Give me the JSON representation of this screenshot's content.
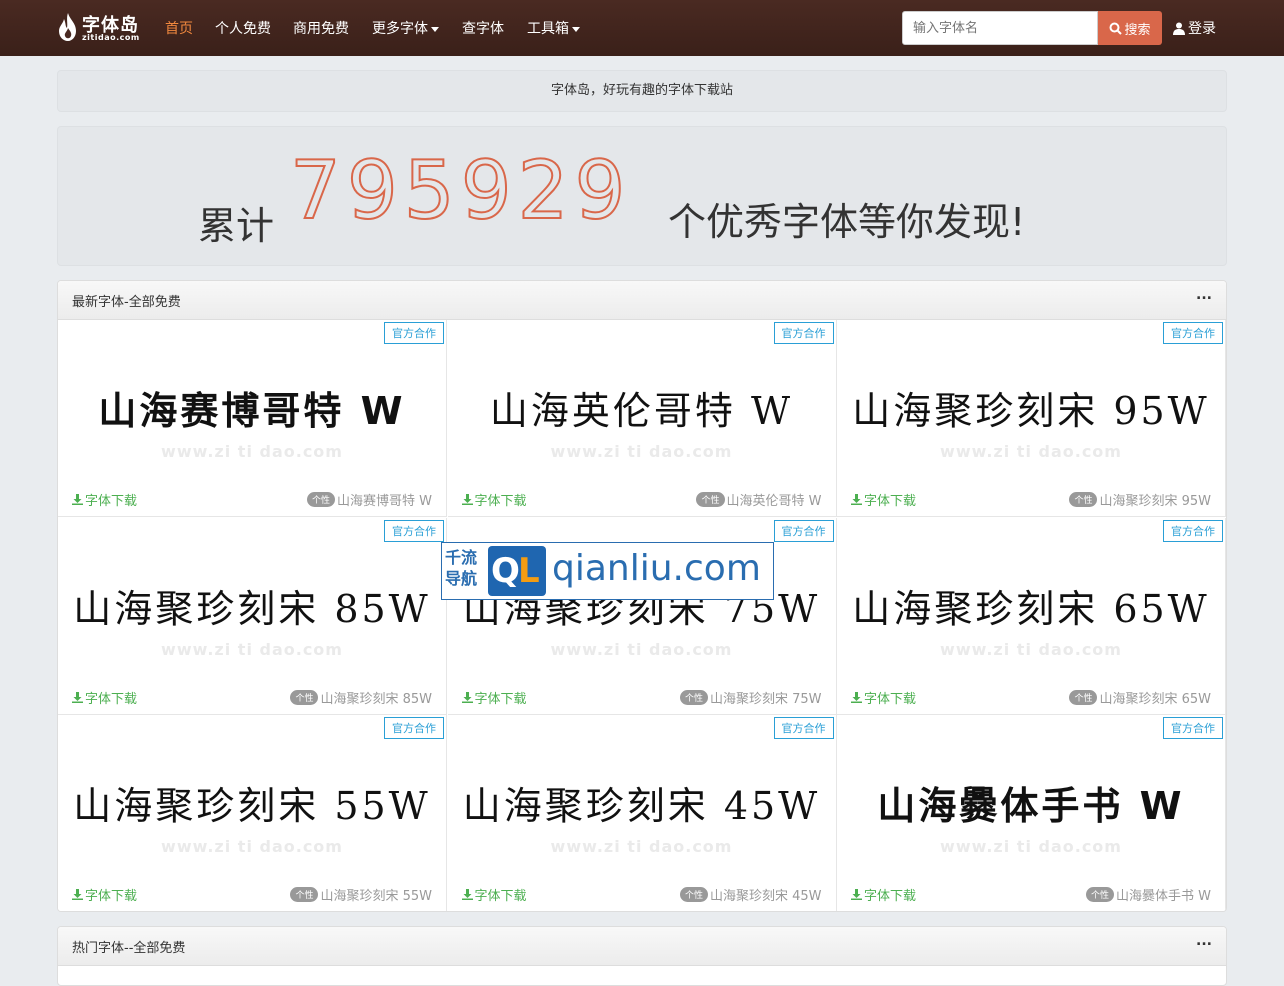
{
  "nav": {
    "logo_text": "字体岛",
    "logo_sub": "zitidao.com",
    "items": [
      {
        "label": "首页",
        "active": true
      },
      {
        "label": "个人免费"
      },
      {
        "label": "商用免费"
      },
      {
        "label": "更多字体",
        "dropdown": true
      },
      {
        "label": "查字体"
      },
      {
        "label": "工具箱",
        "dropdown": true
      }
    ],
    "search_placeholder": "输入字体名",
    "search_label": "搜索",
    "login_label": "登录"
  },
  "notice": "字体岛，好玩有趣的字体下载站",
  "counter": {
    "prefix": "累计",
    "number": "795929",
    "suffix": "个优秀字体等你发现!"
  },
  "latest_panel": {
    "title": "最新字体-全部免费",
    "more": "...",
    "badge": "官方合作",
    "download_label": "字体下载",
    "tag_label": "个性",
    "watermark": "www.zi ti dao.com",
    "cards": [
      {
        "preview": "山海赛博哥特 W",
        "name": "山海赛博哥特 W",
        "style": "bold"
      },
      {
        "preview": "山海英伦哥特 W",
        "name": "山海英伦哥特 W",
        "style": "serif"
      },
      {
        "preview": "山海聚珍刻宋 95W",
        "name": "山海聚珍刻宋 95W",
        "style": "serif"
      },
      {
        "preview": "山海聚珍刻宋 85W",
        "name": "山海聚珍刻宋 85W",
        "style": "serif"
      },
      {
        "preview": "山海聚珍刻宋 75W",
        "name": "山海聚珍刻宋 75W",
        "style": "serif"
      },
      {
        "preview": "山海聚珍刻宋 65W",
        "name": "山海聚珍刻宋 65W",
        "style": "serif"
      },
      {
        "preview": "山海聚珍刻宋 55W",
        "name": "山海聚珍刻宋 55W",
        "style": "serif"
      },
      {
        "preview": "山海聚珍刻宋 45W",
        "name": "山海聚珍刻宋 45W",
        "style": "serif"
      },
      {
        "preview": "山海爨体手书 W",
        "name": "山海爨体手书 W",
        "style": "bold"
      }
    ]
  },
  "hot_panel": {
    "title": "热门字体--全部免费",
    "more": "..."
  },
  "overlay_logo": {
    "left_text_1": "千流",
    "left_text_2": "导航",
    "Q": "Q",
    "L": "L",
    "site": "qianliu.com"
  },
  "colors": {
    "nav_bg": "#3f241c",
    "accent": "#d9674a",
    "active_nav": "#f0883e",
    "badge": "#2a9fd6",
    "download": "#4caf50"
  }
}
